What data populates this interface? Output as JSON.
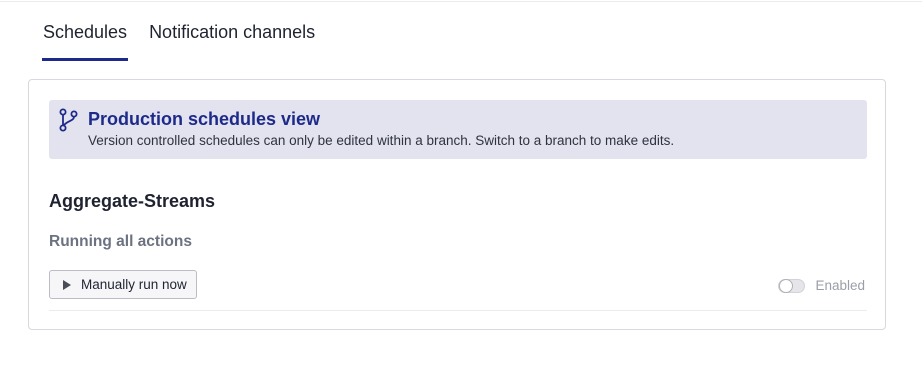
{
  "tabs": [
    {
      "label": "Schedules",
      "active": true
    },
    {
      "label": "Notification channels",
      "active": false
    }
  ],
  "banner": {
    "icon": "git-branch-icon",
    "title": "Production schedules view",
    "message": "Version controlled schedules can only be edited within a branch. Switch to a branch to make edits."
  },
  "schedule": {
    "name": "Aggregate-Streams",
    "status": "Running all actions",
    "run_button_label": "Manually run now",
    "run_button_icon": "play-icon",
    "toggle_label": "Enabled",
    "enabled": false
  },
  "colors": {
    "accent": "#1e2a8a",
    "banner_background": "#e2e3ef",
    "muted_text": "#6d7282"
  }
}
